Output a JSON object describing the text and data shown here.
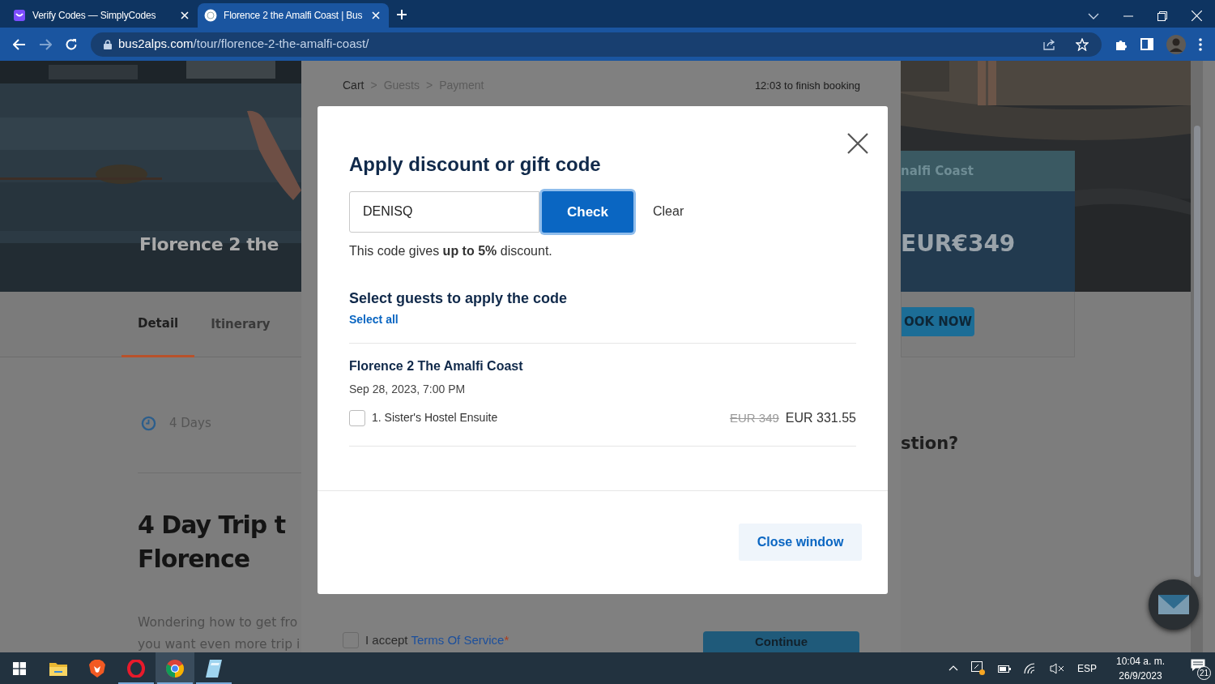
{
  "browser": {
    "tabs": [
      {
        "title": "Verify Codes — SimplyCodes",
        "selected": false
      },
      {
        "title": "Florence 2 the Amalfi Coast | Bus",
        "selected": true
      }
    ],
    "nav": {
      "forward_disabled": true
    },
    "url": {
      "host": "bus2alps.com",
      "path": "/tour/florence-2-the-amalfi-coast/"
    }
  },
  "page": {
    "hero_title": "Florence 2 the",
    "tabs": [
      {
        "label": "Detail",
        "selected": true
      },
      {
        "label": "Itinerary",
        "selected": false
      }
    ],
    "duration": "4 Days",
    "heading": [
      "4 Day Trip t",
      "Florence"
    ],
    "intro": [
      "Wondering how to get fro",
      "you want even more trip i"
    ],
    "price_card": {
      "title": "nalfi Coast",
      "price": "EUR€349",
      "button": "OOK NOW"
    },
    "question_heading": "stion?"
  },
  "checkout": {
    "breadcrumb": [
      {
        "label": "Cart",
        "active": true
      },
      {
        "label": "Guests",
        "active": false
      },
      {
        "label": "Payment",
        "active": false
      }
    ],
    "separators": [
      ">",
      ">"
    ],
    "timer": "12:03 to finish booking",
    "terms": {
      "checked": false,
      "text": "I accept",
      "link": "Terms Of Service",
      "required_mark": "*"
    },
    "continue_button": "Continue"
  },
  "modal": {
    "title": "Apply discount or gift code",
    "code_field": {
      "value": "DENISQ"
    },
    "check_button": {
      "label": "Check",
      "focused": true
    },
    "clear_link": "Clear",
    "hint": "This code gives **up to 5%** discount.",
    "guests_title": "Select guests to apply the code",
    "select_all": "Select all",
    "tour": {
      "name": "Florence 2 The Amalfi Coast",
      "date": "Sep 28, 2023, 7:00 PM",
      "guests": [
        {
          "name": "1. Sister's Hostel Ensuite",
          "checked": false,
          "old_price": "EUR 349",
          "price": "EUR 331.55"
        }
      ]
    },
    "close_button": "Close window"
  },
  "taskbar": {
    "apps": [
      {
        "kind": "start",
        "running": false,
        "selected": false
      },
      {
        "kind": "explorer",
        "running": false,
        "selected": false
      },
      {
        "kind": "brave",
        "running": false,
        "selected": false
      },
      {
        "kind": "opera",
        "running": true,
        "selected": false
      },
      {
        "kind": "chrome",
        "running": true,
        "selected": true
      },
      {
        "kind": "notepad",
        "running": true,
        "selected": false
      }
    ],
    "language": "ESP",
    "time": "10:04 a. m.",
    "date": "26/9/2023",
    "notifications": "21"
  }
}
